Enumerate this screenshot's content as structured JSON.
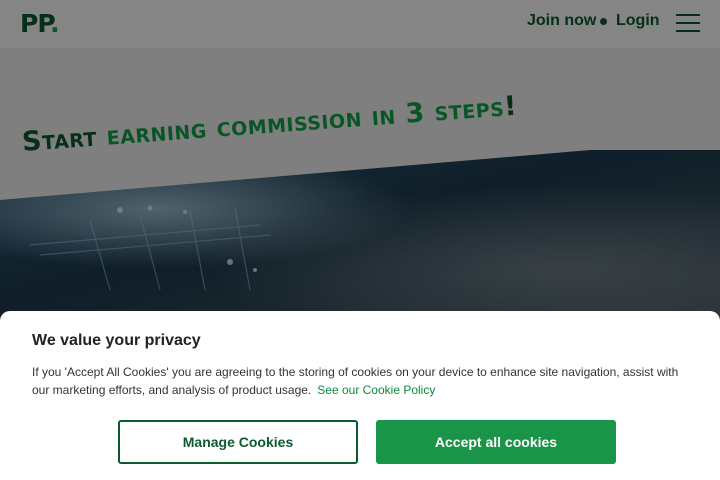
{
  "header": {
    "logo": "PP",
    "logo_dot": ".",
    "join_label": "Join now",
    "login_label": "Login"
  },
  "hero": {
    "title_prefix": "Start ",
    "title_accent": "earning commission in 3 steps",
    "title_suffix": "!"
  },
  "cookie": {
    "title": "We value your privacy",
    "body": "If you 'Accept All Cookies' you are agreeing to the storing of cookies on your device to enhance site navigation, assist with our marketing efforts, and analysis of product usage.",
    "policy_link": "See our Cookie Policy",
    "manage_label": "Manage Cookies",
    "accept_label": "Accept all cookies"
  },
  "colors": {
    "brand_dark": "#0b5b31",
    "brand_green": "#10a64a",
    "accept_button": "#1a9448"
  },
  "icons": {
    "menu": "hamburger-menu-icon"
  }
}
